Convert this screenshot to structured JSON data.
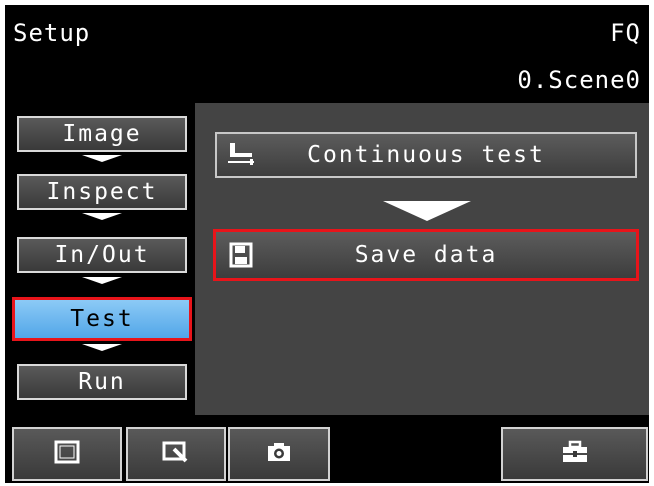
{
  "header": {
    "mode": "Setup",
    "device": "FQ",
    "scene": "0.Scene0"
  },
  "sidebar": {
    "items": [
      {
        "label": "Image"
      },
      {
        "label": "Inspect"
      },
      {
        "label": "In/Out"
      },
      {
        "label": "Test"
      },
      {
        "label": "Run"
      }
    ]
  },
  "main": {
    "continuous_test_label": "Continuous test",
    "save_data_label": "Save data"
  },
  "toolbar": {
    "buttons": [
      {
        "icon": "frame-icon"
      },
      {
        "icon": "zoom-window-icon"
      },
      {
        "icon": "camera-icon"
      },
      {
        "icon": "toolbox-icon"
      }
    ]
  },
  "colors": {
    "highlight": "#e8141a",
    "active_button": "#6cb8f0",
    "panel": "#444444"
  }
}
